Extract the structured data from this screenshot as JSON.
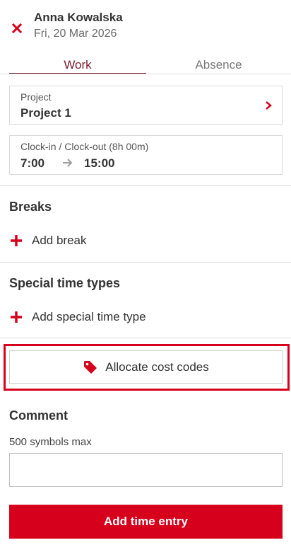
{
  "header": {
    "user_name": "Anna Kowalska",
    "date": "Fri, 20 Mar 2026",
    "close_icon": "close-icon"
  },
  "tabs": [
    {
      "label": "Work",
      "active": true
    },
    {
      "label": "Absence",
      "active": false
    }
  ],
  "project": {
    "label": "Project",
    "value": "Project 1"
  },
  "clock": {
    "label": "Clock-in / Clock-out (8h 00m)",
    "clock_in": "7:00",
    "clock_out": "15:00"
  },
  "breaks": {
    "title": "Breaks",
    "add_label": "Add break"
  },
  "special": {
    "title": "Special time types",
    "add_label": "Add special time type"
  },
  "allocate": {
    "label": "Allocate cost codes",
    "icon": "tag-icon"
  },
  "comment": {
    "title": "Comment",
    "hint": "500 symbols max",
    "value": ""
  },
  "submit": {
    "label": "Add time entry"
  },
  "colors": {
    "accent": "#d6001c",
    "tab_active": "#7a1b2d",
    "highlight_border": "#d6001c"
  }
}
